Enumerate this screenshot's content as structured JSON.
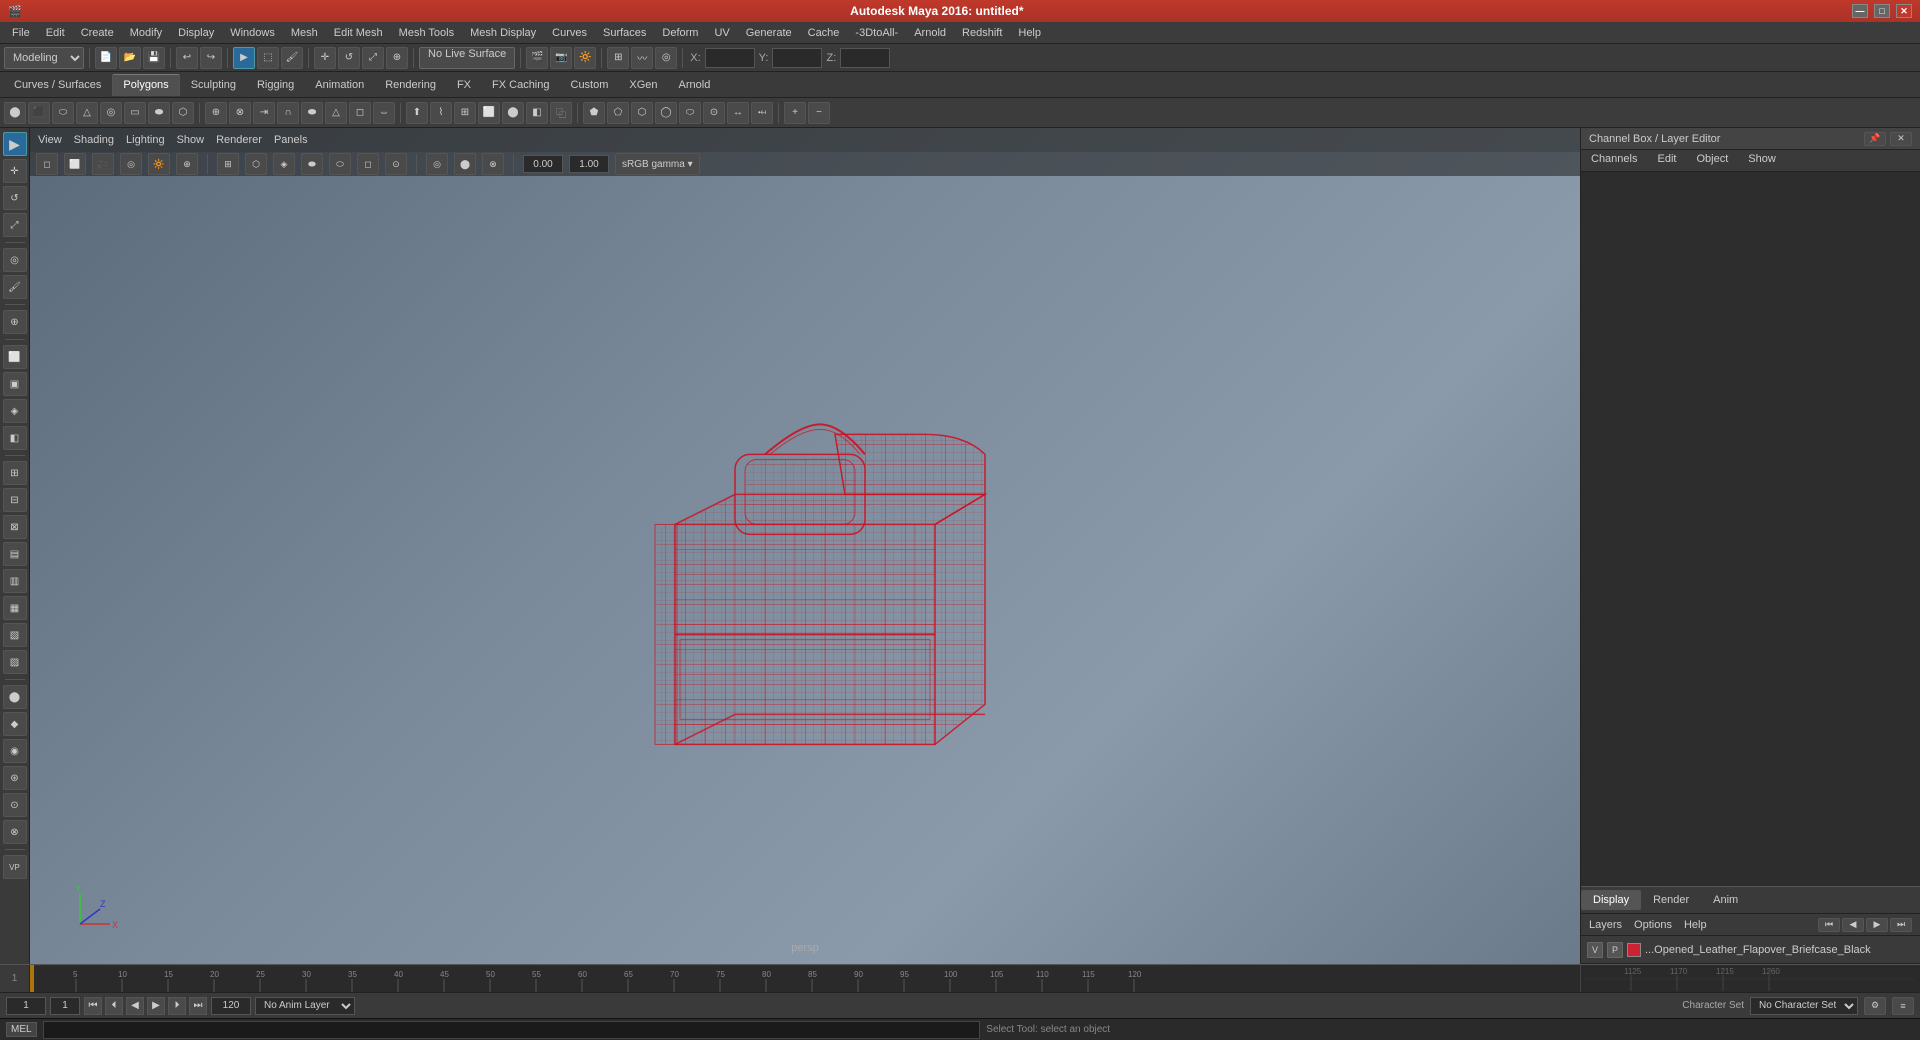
{
  "app": {
    "title": "Autodesk Maya 2016: untitled*",
    "window_controls": [
      "—",
      "□",
      "✕"
    ]
  },
  "menu_bar": {
    "items": [
      "File",
      "Edit",
      "Create",
      "Modify",
      "Display",
      "Windows",
      "Mesh",
      "Edit Mesh",
      "Mesh Tools",
      "Mesh Display",
      "Curves",
      "Surfaces",
      "Deform",
      "UV",
      "Generate",
      "Cache",
      "-3DtoAll-",
      "Arnold",
      "Redshift",
      "Help"
    ]
  },
  "toolbar1": {
    "mode_label": "Modeling",
    "no_live_label": "No Live Surface",
    "x_label": "X:",
    "y_label": "Y:",
    "z_label": "Z:"
  },
  "tabs": {
    "items": [
      "Curves / Surfaces",
      "Polygons",
      "Sculpting",
      "Rigging",
      "Animation",
      "Rendering",
      "FX",
      "FX Caching",
      "Custom",
      "XGen",
      "Arnold"
    ],
    "active": "Polygons"
  },
  "viewport": {
    "menu_items": [
      "View",
      "Shading",
      "Lighting",
      "Show",
      "Renderer",
      "Panels"
    ],
    "persp_label": "persp",
    "gamma_label": "sRGB gamma",
    "gamma_value": "1.00",
    "field_value": "0.00"
  },
  "right_panel": {
    "title": "Channel Box / Layer Editor",
    "close_label": "✕",
    "tabs": [
      "Channels",
      "Edit",
      "Object",
      "Show"
    ],
    "display_tabs": [
      "Display",
      "Render",
      "Anim"
    ],
    "active_display_tab": "Display",
    "layer_tabs": [
      "Layers",
      "Options",
      "Help"
    ],
    "layer": {
      "v_label": "V",
      "p_label": "P",
      "name": "...Opened_Leather_Flapover_Briefcase_Black"
    },
    "layer_controls": [
      "⏮",
      "◀",
      "▶",
      "⏭"
    ]
  },
  "timeline": {
    "start": 1,
    "end": 120,
    "current": 1,
    "ticks": [
      1,
      5,
      10,
      15,
      20,
      25,
      30,
      35,
      40,
      45,
      50,
      55,
      60,
      65,
      70,
      75,
      80,
      85,
      90,
      95,
      100,
      105,
      110,
      115,
      120,
      1125,
      1170,
      1215,
      1260
    ]
  },
  "bottom_bar": {
    "start_frame": "1",
    "end_frame": "120",
    "current_frame": "1",
    "anim_layer": "No Anim Layer",
    "char_set_label": "Character Set",
    "char_set_value": "No Character Set"
  },
  "mel_bar": {
    "label": "MEL",
    "status": "Select Tool: select an object",
    "input_placeholder": ""
  },
  "icons": {
    "select": "▶",
    "move": "✛",
    "rotate": "↺",
    "scale": "⤢",
    "gear": "⚙",
    "eye": "👁",
    "sphere": "○",
    "cube": "□",
    "cylinder": "⬭"
  }
}
